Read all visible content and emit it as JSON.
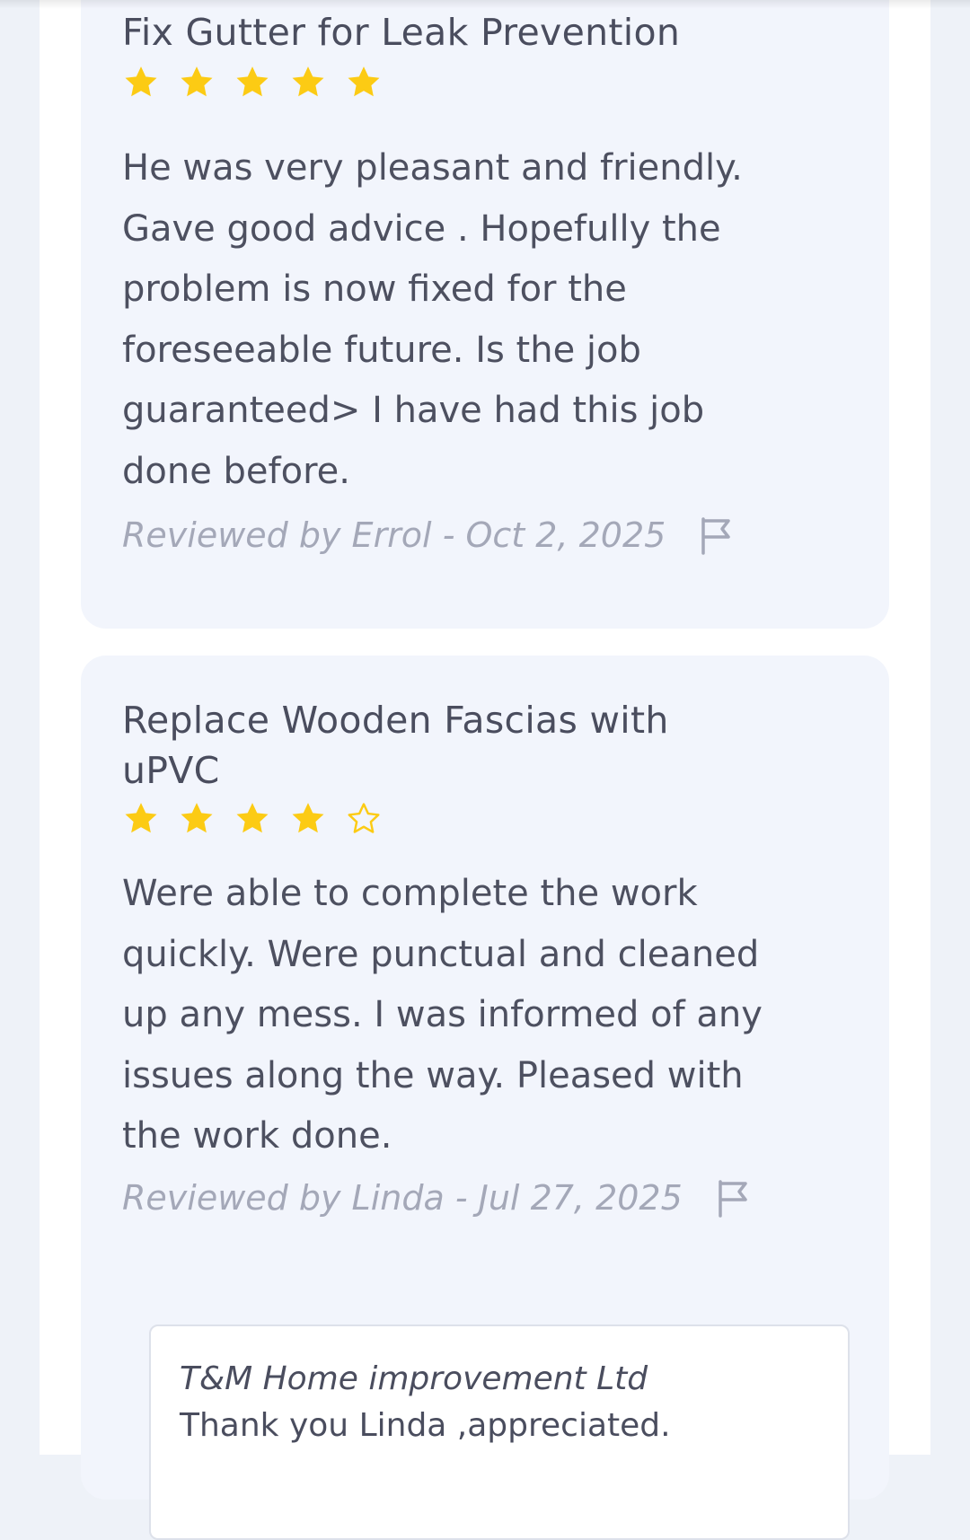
{
  "reviews": [
    {
      "title": "Fix Gutter for Leak Prevention",
      "rating": 5,
      "max_rating": 5,
      "body": "He was very pleasant and friendly. Gave good advice . Hopefully the problem is now fixed for the foreseeable future. Is the job guaranteed> I have had this job done before.",
      "body_lines": [
        "He was very pleasant and friendly.",
        "Gave good advice . Hopefully the",
        "problem is now fixed for the",
        "foreseeable future. Is the job",
        "guaranteed> I have had this job",
        "done before."
      ],
      "meta": "Reviewed by Errol - Oct 2, 2025"
    },
    {
      "title": "Replace Wooden Fascias with uPVC",
      "title_lines": [
        "Replace Wooden Fascias with",
        "uPVC"
      ],
      "rating": 4,
      "max_rating": 5,
      "body": "Were able to complete the work quickly. Were punctual and cleaned up any mess. I was informed of any issues along the way. Pleased with the work done.",
      "body_lines": [
        "Were able to complete the work",
        "quickly. Were punctual and cleaned",
        "up any mess. I was informed of any",
        "issues along the way. Pleased with",
        "the work done."
      ],
      "meta": "Reviewed by Linda - Jul 27, 2025",
      "reply": {
        "company": "T&M Home improvement Ltd",
        "text": "Thank you Linda ,appreciated."
      }
    }
  ],
  "colors": {
    "star_filled": "#fccb14",
    "star_empty_outline": "#fccb14",
    "card_background": "#f2f5fc",
    "page_background": "#eef2f8",
    "text_primary": "#4a4d5e",
    "text_meta": "#a4a8b8"
  },
  "icons": {
    "star": "star-icon",
    "empty_star": "star-outline-icon",
    "report": "flag-icon"
  }
}
